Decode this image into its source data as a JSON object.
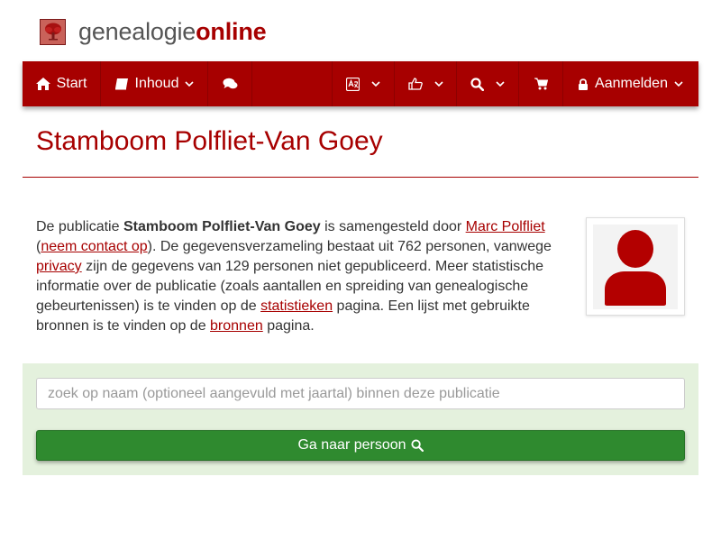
{
  "brand": {
    "part1": "genealogie",
    "part2": "online"
  },
  "nav": {
    "start": "Start",
    "contents": "Inhoud",
    "login": "Aanmelden"
  },
  "page": {
    "title": "Stamboom Polfliet-Van Goey"
  },
  "intro": {
    "t1": "De publicatie ",
    "publication": "Stamboom Polfliet-Van Goey",
    "t2": " is samengesteld door ",
    "author_link": "Marc Polfliet",
    "t3": " (",
    "contact_link": "neem contact op",
    "t4": "). De gegevensverzameling bestaat uit 762 personen, vanwege ",
    "privacy_link": "privacy",
    "t5": " zijn de gegevens van 129 personen niet gepubliceerd. Meer statistische informatie over de publicatie (zoals aantallen en spreiding van genealogische gebeurtenissen) is te vinden op de ",
    "stats_link": "statistieken",
    "t6": " pagina. Een lijst met gebruikte bronnen is te vinden op de ",
    "sources_link": "bronnen",
    "t7": " pagina."
  },
  "search": {
    "placeholder": "zoek op naam (optioneel aangevuld met jaartal) binnen deze publicatie",
    "value": "",
    "button_label": "Ga naar persoon"
  },
  "colors": {
    "brand_red": "#a70000",
    "panel_green": "#e4f1dd",
    "button_green": "#2f8a2f"
  },
  "icons": {
    "home": "home-icon",
    "book": "book-icon",
    "chat": "comments-icon",
    "language": "language-icon",
    "thumbs": "thumbs-up-icon",
    "search": "search-icon",
    "cart": "shopping-cart-icon",
    "lock": "lock-icon",
    "avatar": "user-avatar-icon"
  }
}
